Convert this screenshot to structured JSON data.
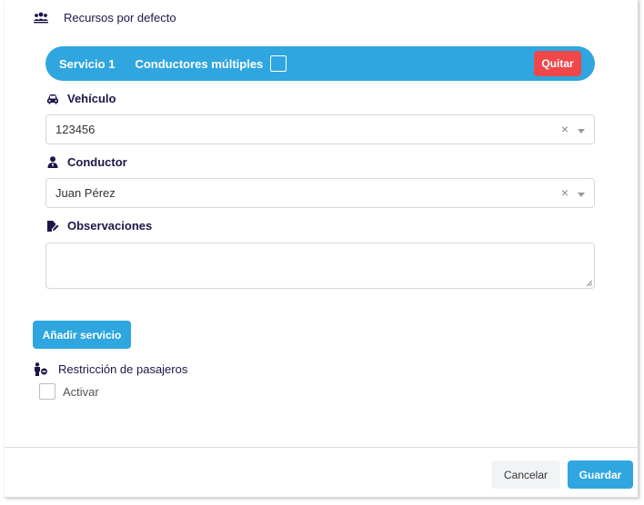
{
  "header": {
    "title": "Recursos por defecto",
    "icon": "users-group-icon"
  },
  "service": {
    "title": "Servicio 1",
    "multiple_drivers_label": "Conductores múltiples",
    "multiple_drivers_checked": false,
    "remove_label": "Quitar"
  },
  "vehicle": {
    "label": "Vehículo",
    "icon": "car-icon",
    "value": "123456",
    "clear": "×"
  },
  "driver": {
    "label": "Conductor",
    "icon": "person-tie-icon",
    "value": "Juan Pérez",
    "clear": "×"
  },
  "observations": {
    "label": "Observaciones",
    "icon": "edit-file-icon",
    "value": ""
  },
  "add_service_label": "Añadir servicio",
  "restriction": {
    "label": "Restricción de pasajeros",
    "icon": "person-restrict-icon",
    "activate_label": "Activar",
    "checked": false
  },
  "footer": {
    "cancel_label": "Cancelar",
    "save_label": "Guardar"
  },
  "colors": {
    "accent": "#2fa6df",
    "danger": "#f0474a",
    "text": "#1f1446"
  }
}
